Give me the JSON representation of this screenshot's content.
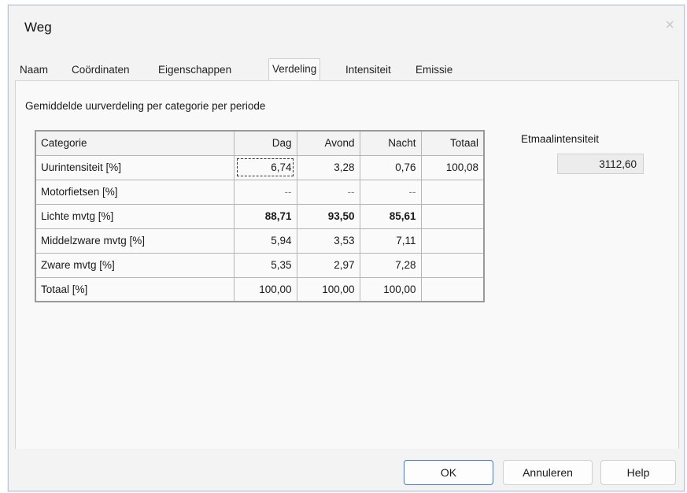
{
  "window": {
    "title": "Weg",
    "close_glyph": "×"
  },
  "tabs": [
    {
      "label": "Naam",
      "active": false
    },
    {
      "label": "Coördinaten",
      "active": false
    },
    {
      "label": "Eigenschappen",
      "active": false
    },
    {
      "label": "Verdeling",
      "active": true
    },
    {
      "label": "Intensiteit",
      "active": false
    },
    {
      "label": "Emissie",
      "active": false
    }
  ],
  "section_label": "Gemiddelde uurverdeling per categorie per periode",
  "table": {
    "headers": [
      "Categorie",
      "Dag",
      "Avond",
      "Nacht",
      "Totaal"
    ],
    "rows": [
      [
        "Uurintensiteit [%]",
        "6,74",
        "3,28",
        "0,76",
        "100,08"
      ],
      [
        "Motorfietsen [%]",
        "--",
        "--",
        "--",
        ""
      ],
      [
        "Lichte mvtg [%]",
        "88,71",
        "93,50",
        "85,61",
        ""
      ],
      [
        "Middelzware mvtg [%]",
        "5,94",
        "3,53",
        "7,11",
        ""
      ],
      [
        "Zware mvtg [%]",
        "5,35",
        "2,97",
        "7,28",
        ""
      ],
      [
        "Totaal [%]",
        "100,00",
        "100,00",
        "100,00",
        ""
      ]
    ]
  },
  "etmaal": {
    "label": "Etmaalintensiteit",
    "value": "3112,60"
  },
  "buttons": {
    "ok": "OK",
    "cancel": "Annuleren",
    "help": "Help"
  }
}
